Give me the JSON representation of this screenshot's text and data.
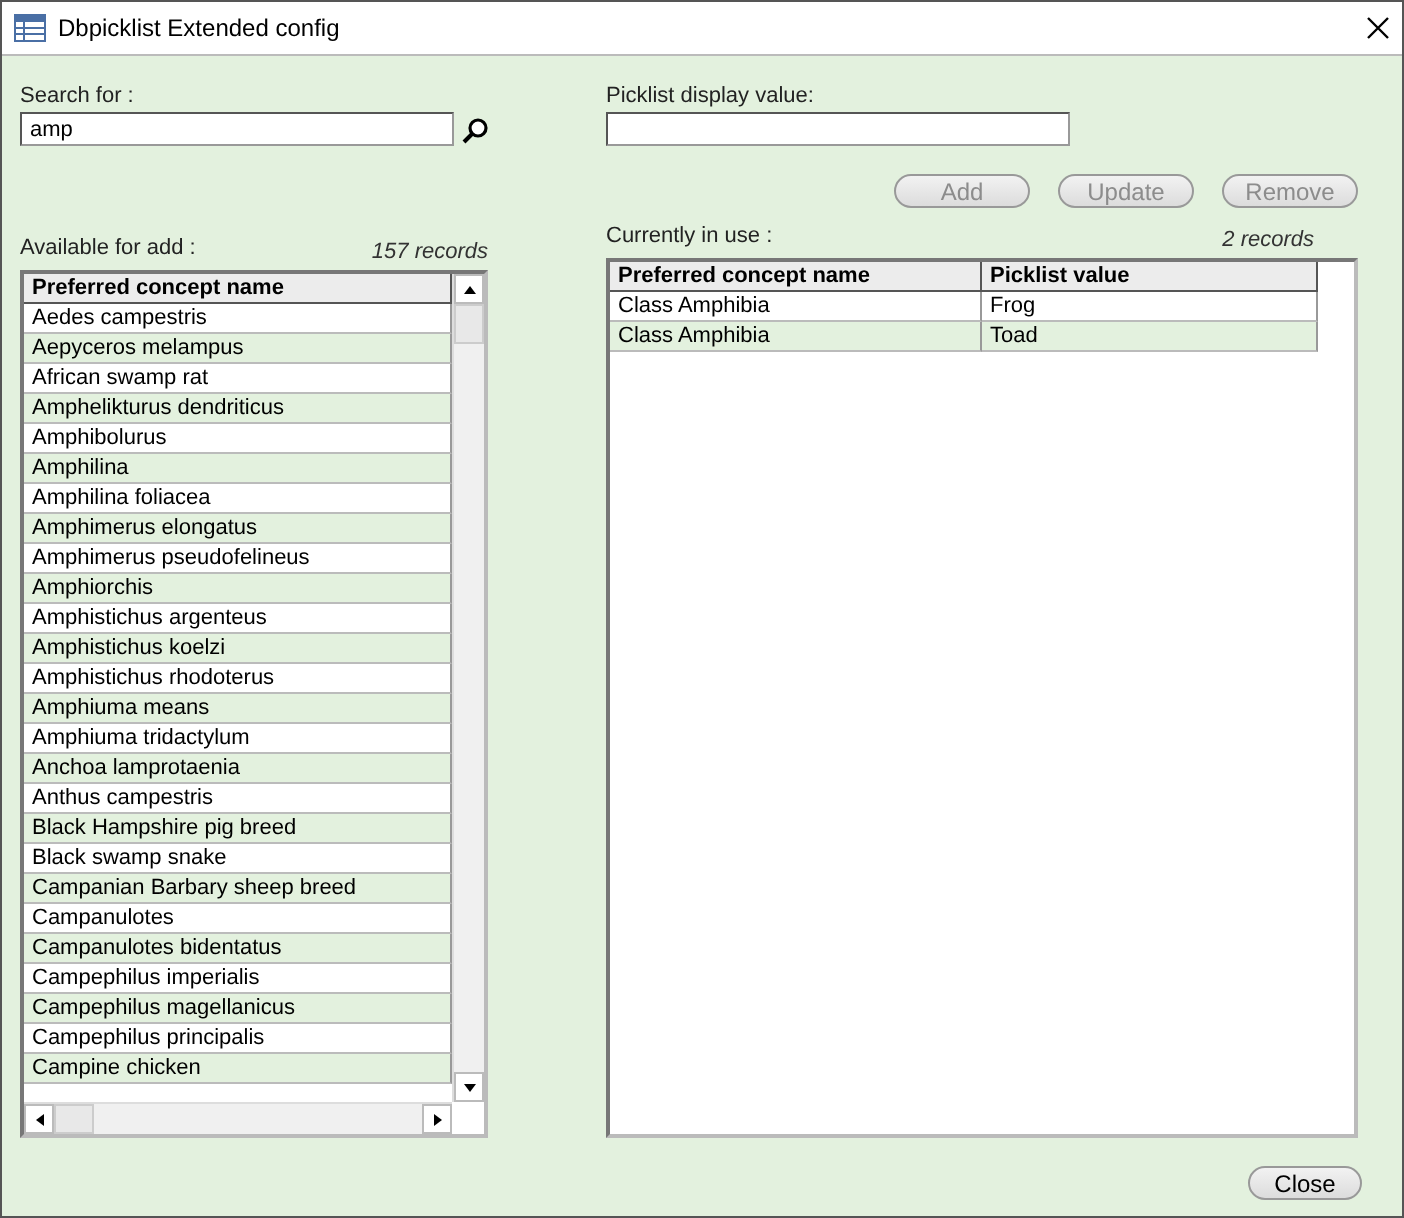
{
  "window": {
    "title": "Dbpicklist Extended config"
  },
  "search": {
    "label": "Search for :",
    "value": "amp"
  },
  "display_value": {
    "label": "Picklist display value:"
  },
  "buttons": [
    {
      "label": "Add",
      "disabled": true
    },
    {
      "label": "Update",
      "disabled": true
    },
    {
      "label": "Remove",
      "disabled": true
    }
  ],
  "available": {
    "label": "Available for add :",
    "count": "157 records",
    "columns": [
      "Preferred concept name"
    ],
    "rows": [
      "Aedes campestris",
      "Aepyceros melampus",
      "African swamp rat",
      "Amphelikturus dendriticus",
      "Amphibolurus",
      "Amphilina",
      "Amphilina foliacea",
      "Amphimerus elongatus",
      "Amphimerus pseudofelineus",
      "Amphiorchis",
      "Amphistichus argenteus",
      "Amphistichus koelzi",
      "Amphistichus rhodoterus",
      "Amphiuma means",
      "Amphiuma tridactylum",
      "Anchoa lamprotaenia",
      "Anthus campestris",
      "Black Hampshire pig breed",
      "Black swamp snake",
      "Campanian Barbary sheep breed",
      "Campanulotes",
      "Campanulotes bidentatus",
      "Campephilus imperialis",
      "Campephilus magellanicus",
      "Campephilus principalis",
      "Campine chicken"
    ]
  },
  "in_use": {
    "label": "Currently in use :",
    "count": "2 records",
    "columns": [
      "Preferred concept name",
      "Picklist value"
    ],
    "rows": [
      [
        "Class Amphibia",
        "Frog"
      ],
      [
        "Class Amphibia",
        "Toad"
      ]
    ]
  },
  "close_button": {
    "label": "Close"
  }
}
